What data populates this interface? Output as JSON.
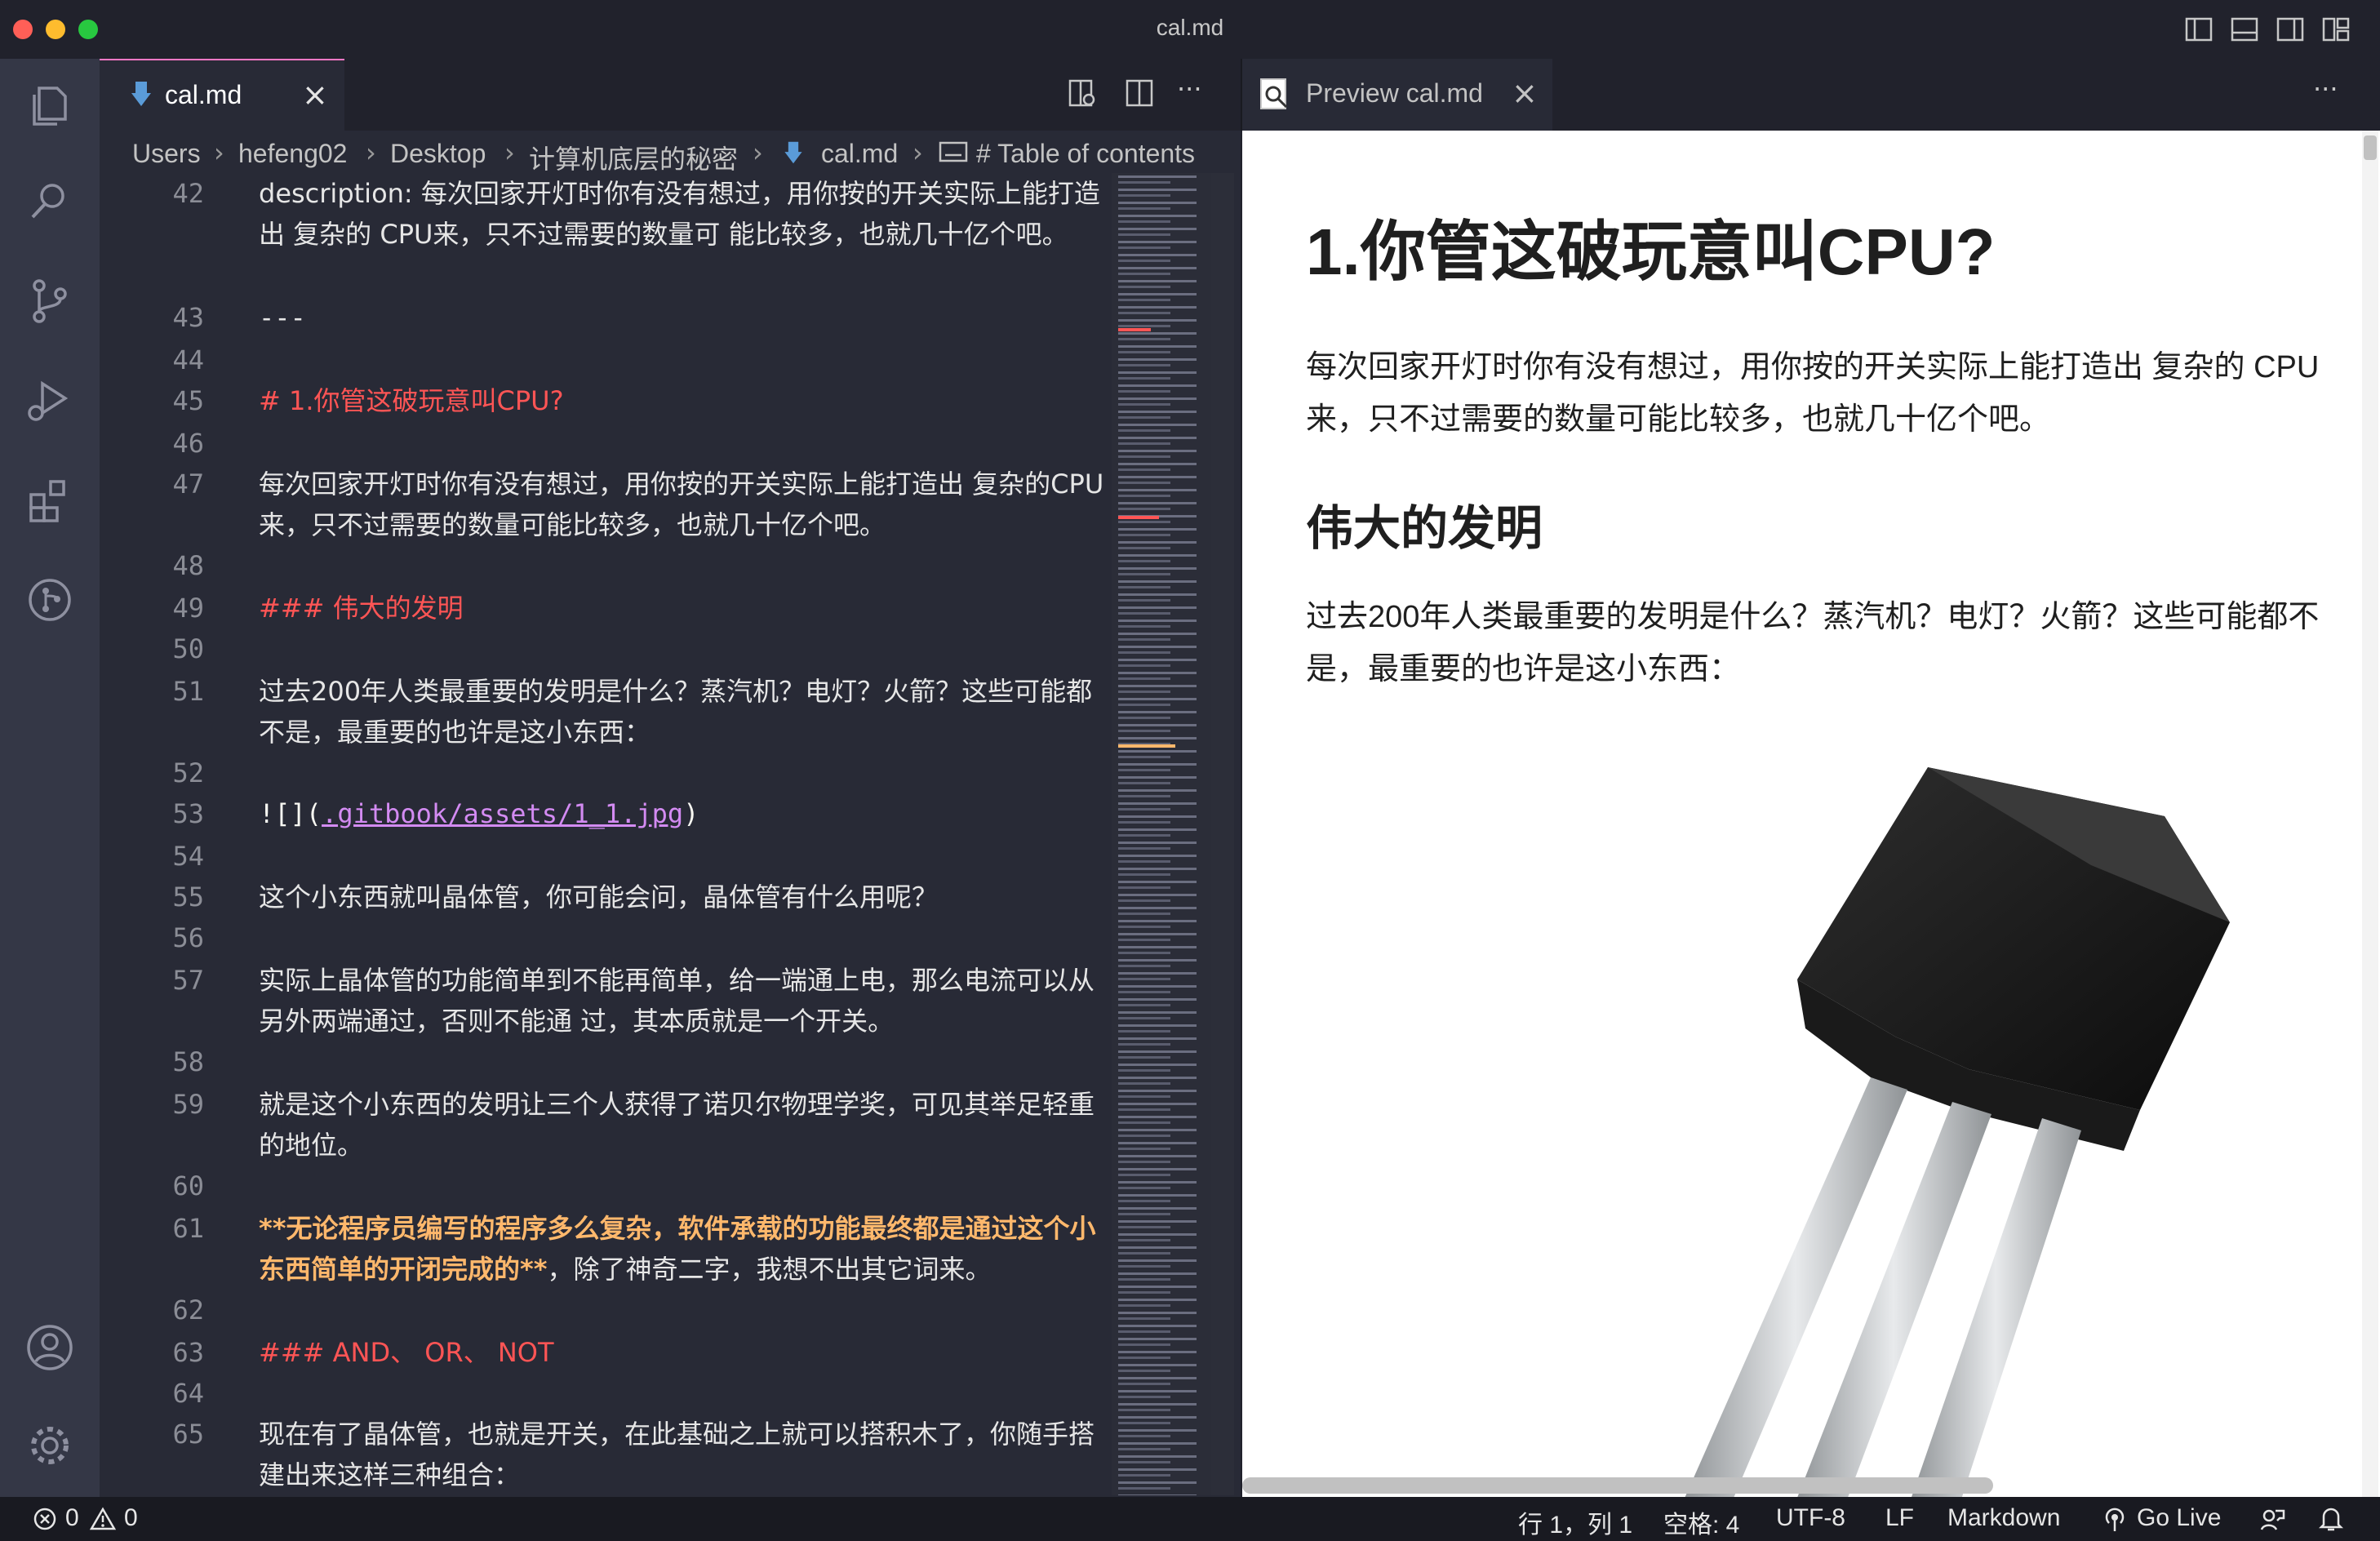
{
  "window": {
    "title": "cal.md"
  },
  "editor": {
    "tab": {
      "label": "cal.md",
      "close": "×"
    },
    "breadcrumbs": [
      "Users",
      "hefeng02",
      "Desktop",
      "计算机底层的秘密",
      "cal.md",
      "# Table of contents"
    ],
    "lines": [
      {
        "n": "42",
        "text": "description: 每次回家开灯时你有没有想过，用你按的开关实际上能打造出 复杂的 CPU来，只不过需要的数量可 能比较多，也就几十亿个吧。"
      },
      {
        "n": "43",
        "text": "---"
      },
      {
        "n": "44",
        "text": ""
      },
      {
        "n": "45",
        "text": "# 1.你管这破玩意叫CPU?"
      },
      {
        "n": "46",
        "text": ""
      },
      {
        "n": "47",
        "text": "每次回家开灯时你有没有想过，用你按的开关实际上能打造出 复杂的CPU来，只不过需要的数量可能比较多，也就几十亿个吧。"
      },
      {
        "n": "48",
        "text": ""
      },
      {
        "n": "49",
        "text": "### 伟大的发明"
      },
      {
        "n": "50",
        "text": ""
      },
      {
        "n": "51",
        "text": "过去200年人类最重要的发明是什么？蒸汽机？电灯？火箭？这些可能都不是，最重要的也许是这小东西："
      },
      {
        "n": "52",
        "text": ""
      },
      {
        "n": "53",
        "prefix": "![](",
        "link": ".gitbook/assets/1_1.jpg",
        "suffix": ")"
      },
      {
        "n": "54",
        "text": ""
      },
      {
        "n": "55",
        "text": "这个小东西就叫晶体管，你可能会问，晶体管有什么用呢？"
      },
      {
        "n": "56",
        "text": ""
      },
      {
        "n": "57",
        "text": "实际上晶体管的功能简单到不能再简单，给一端通上电，那么电流可以从另外两端通过，否则不能通 过，其本质就是一个开关。"
      },
      {
        "n": "58",
        "text": ""
      },
      {
        "n": "59",
        "text": "就是这个小东西的发明让三个人获得了诺贝尔物理学奖，可见其举足轻重的地位。"
      },
      {
        "n": "60",
        "text": ""
      },
      {
        "n": "61",
        "strong": "**无论程序员编写的程序多么复杂，软件承载的功能最终都是通过这个小东西简单的开闭完成的**",
        "rest": "，除了神奇二字，我想不出其它词来。"
      },
      {
        "n": "62",
        "text": ""
      },
      {
        "n": "63",
        "text": "### AND、 OR、 NOT"
      },
      {
        "n": "64",
        "text": ""
      },
      {
        "n": "65",
        "text": "现在有了晶体管，也就是开关，在此基础之上就可以搭积木了，你随手搭建出来这样三种组合："
      }
    ]
  },
  "preview": {
    "tab": {
      "label": "Preview cal.md",
      "close": "×"
    },
    "more": "···",
    "h1": "1.你管这破玩意叫CPU?",
    "p1": "每次回家开灯时你有没有想过，用你按的开关实际上能打造出 复杂的 CPU来，只不过需要的数量可能比较多，也就几十亿个吧。",
    "h3": "伟大的发明",
    "p2": "过去200年人类最重要的发明是什么？蒸汽机？电灯？火箭？这些可能都不是，最重要的也许是这小东西："
  },
  "editor_actions": {
    "more": "···"
  },
  "status": {
    "errors": "0",
    "warnings": "0",
    "position": "行 1，列 1",
    "spaces": "空格: 4",
    "encoding": "UTF-8",
    "eol": "LF",
    "language": "Markdown",
    "golive": "Go Live"
  },
  "theme": {
    "accent": "#ff79c6",
    "heading": "#ff5555",
    "bold": "#ffb86c",
    "link": "#d38bf2"
  }
}
